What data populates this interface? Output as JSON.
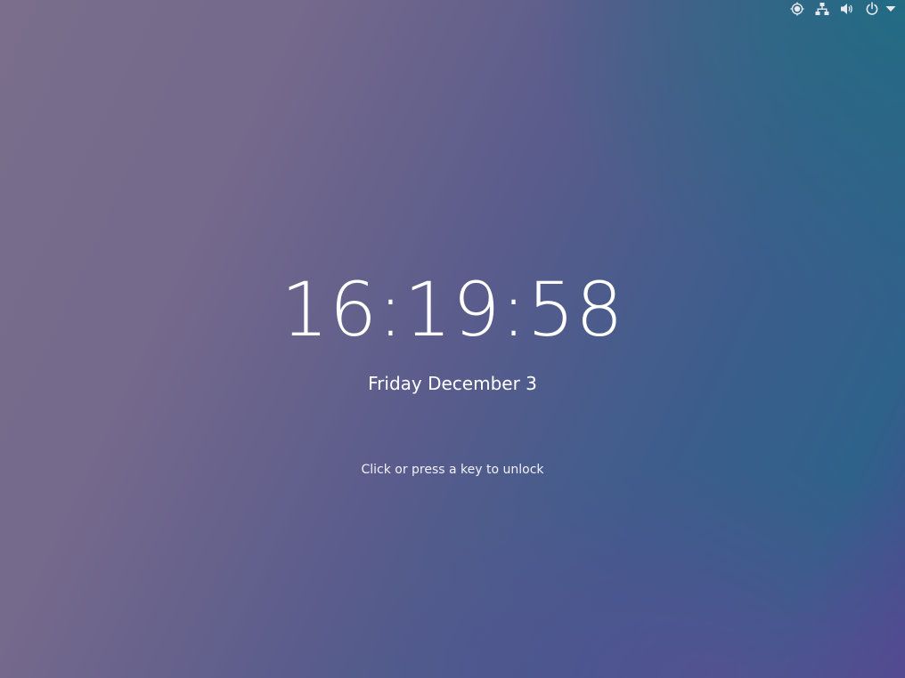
{
  "lock_screen": {
    "time": "16:19:58",
    "date": "Friday December 3",
    "unlock_hint": "Click or press a key to unlock"
  },
  "top_bar": {
    "icons": [
      "brightness-icon",
      "network-wired-icon",
      "volume-icon",
      "power-icon",
      "dropdown-arrow-icon"
    ]
  },
  "colors": {
    "background_left": "#7a6e8c",
    "background_right_top": "#2e628a",
    "background_right_bottom": "#4a4a90",
    "text": "#ffffff"
  }
}
